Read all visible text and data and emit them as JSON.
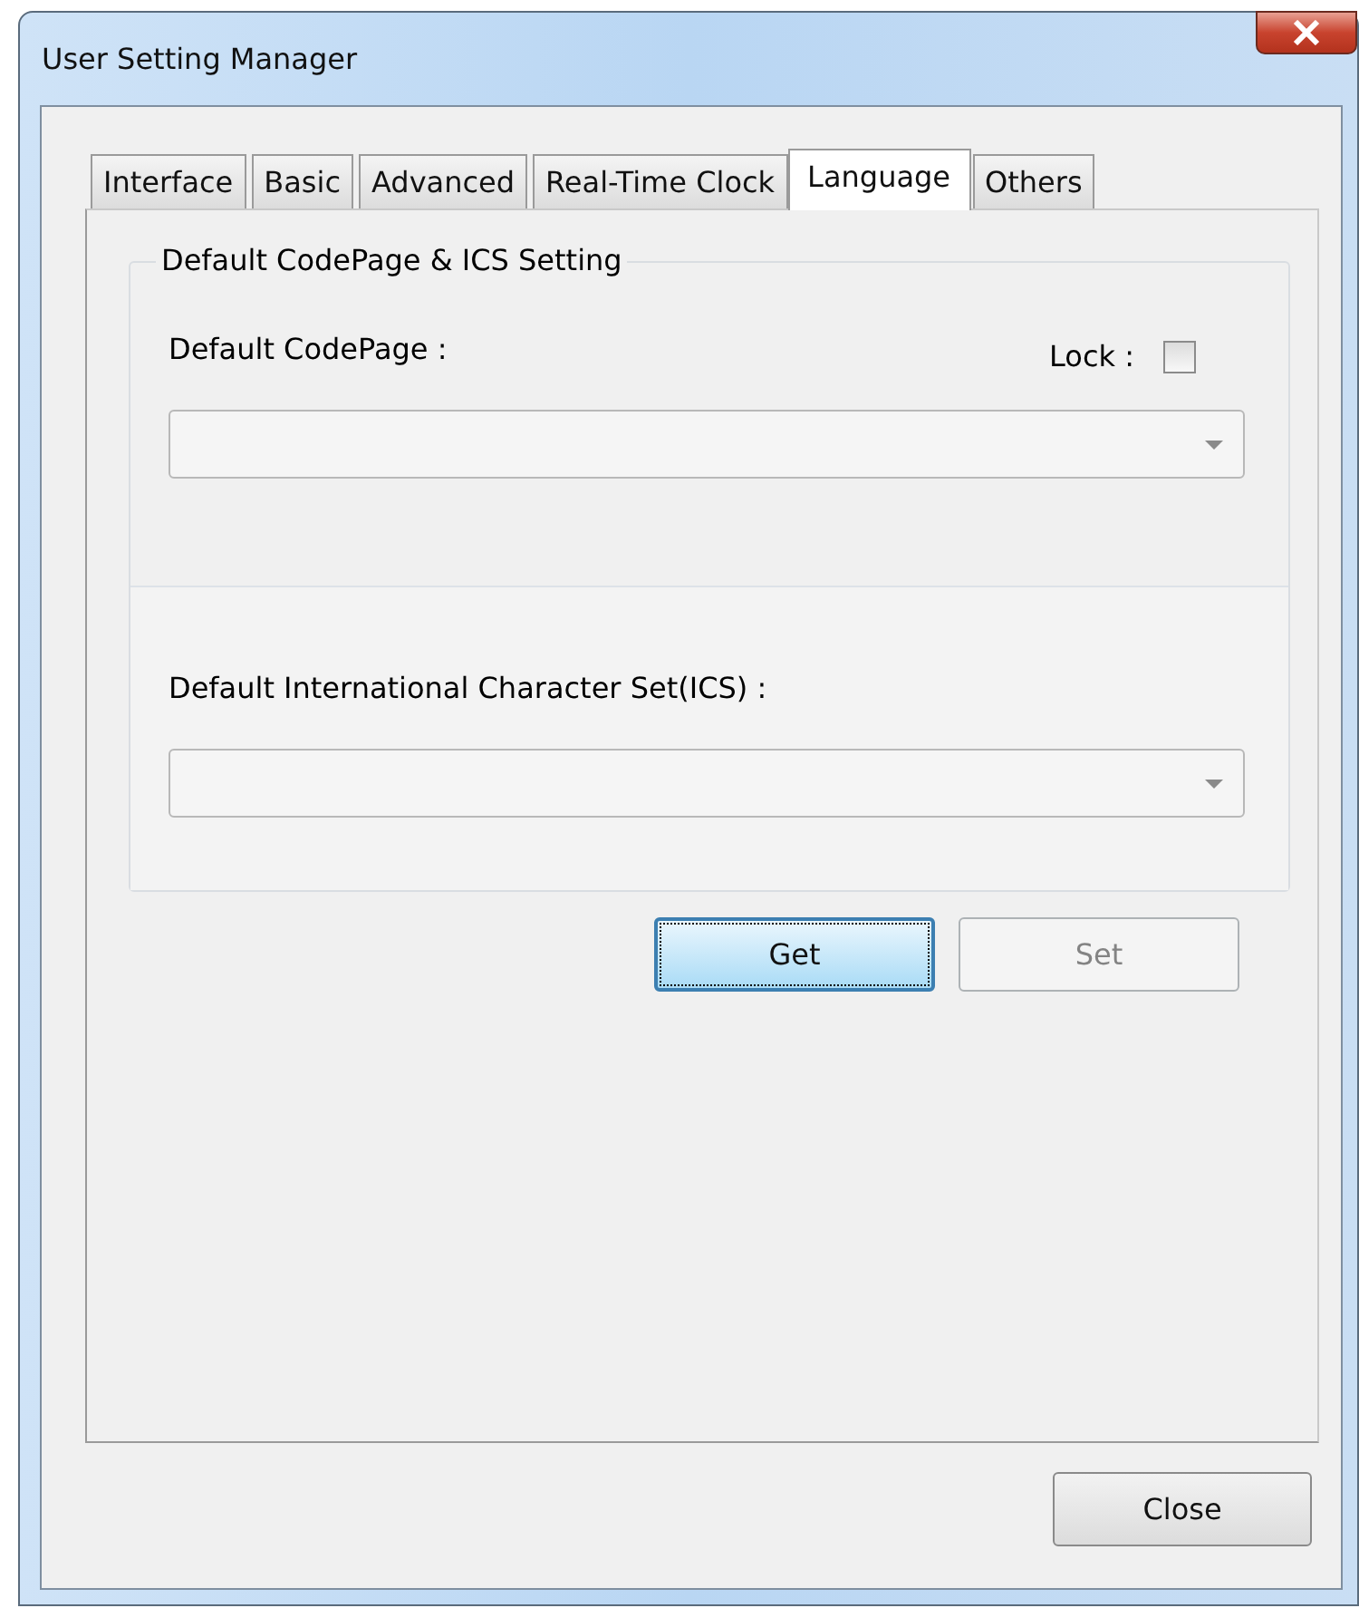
{
  "window": {
    "title": "User Setting Manager"
  },
  "tabs": [
    {
      "label": "Interface",
      "selected": false
    },
    {
      "label": "Basic",
      "selected": false
    },
    {
      "label": "Advanced",
      "selected": false
    },
    {
      "label": "Real-Time Clock",
      "selected": false
    },
    {
      "label": "Language",
      "selected": true
    },
    {
      "label": "Others",
      "selected": false
    }
  ],
  "group": {
    "title": "Default CodePage & ICS Setting",
    "codepage_label": "Default CodePage  :",
    "lock": {
      "label": "Lock :",
      "checked": false
    },
    "codepage_dropdown": {
      "disabled": true
    },
    "ics_label": "Default International Character Set(ICS) :",
    "ics_dropdown": {
      "disabled": true
    }
  },
  "actions": [
    {
      "label": "Get",
      "default": true,
      "disabled": false
    },
    {
      "label": "Set",
      "default": false,
      "disabled": true
    }
  ],
  "close_button": {
    "label": "Close"
  }
}
